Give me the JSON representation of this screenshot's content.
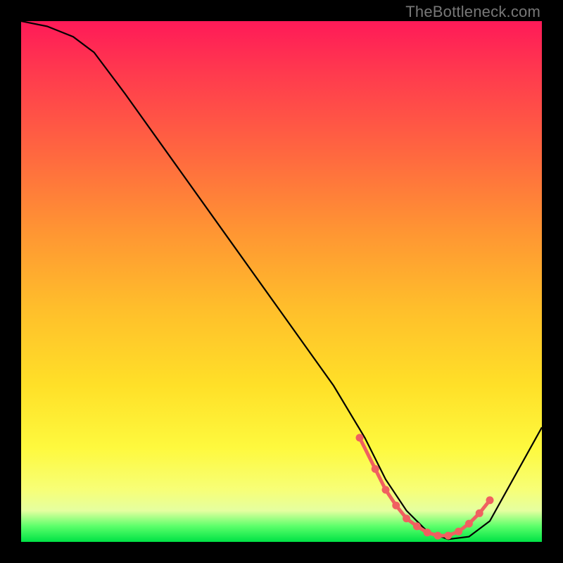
{
  "watermark": "TheBottleneck.com",
  "chart_data": {
    "type": "line",
    "title": "",
    "xlabel": "",
    "ylabel": "",
    "xlim": [
      0,
      100
    ],
    "ylim": [
      0,
      100
    ],
    "series": [
      {
        "name": "curve",
        "x": [
          0,
          5,
          10,
          14,
          20,
          30,
          40,
          50,
          60,
          66,
          70,
          74,
          78,
          82,
          86,
          90,
          100
        ],
        "y": [
          100,
          99,
          97,
          94,
          86,
          72,
          58,
          44,
          30,
          20,
          12,
          6,
          2,
          0.5,
          1,
          4,
          22
        ]
      }
    ],
    "markers": {
      "name": "bottleneck-band",
      "color": "#f06060",
      "x": [
        65,
        68,
        70,
        72,
        74,
        76,
        78,
        80,
        82,
        84,
        86,
        88,
        90
      ],
      "y": [
        20,
        14,
        10,
        7,
        4.5,
        3,
        1.8,
        1.2,
        1.2,
        2,
        3.5,
        5.5,
        8
      ]
    }
  }
}
